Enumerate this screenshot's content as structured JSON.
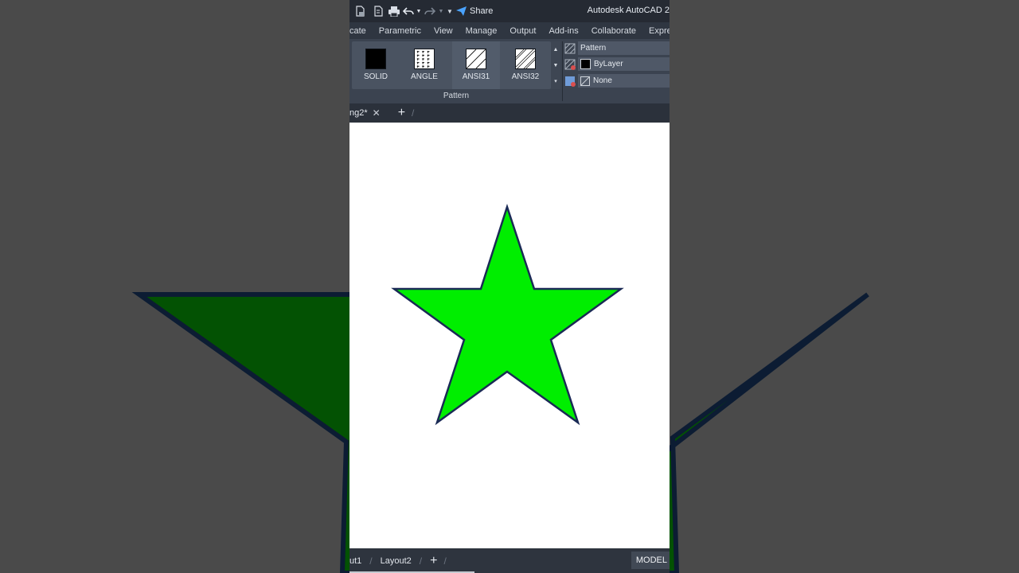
{
  "app": {
    "title": "Autodesk AutoCAD 2",
    "share_label": "Share"
  },
  "ribbon": {
    "tabs": [
      "cate",
      "Parametric",
      "View",
      "Manage",
      "Output",
      "Add-ins",
      "Collaborate",
      "Express Tool"
    ],
    "patterns": [
      {
        "label": "SOLID",
        "icon": "solid-swatch-icon"
      },
      {
        "label": "ANGLE",
        "icon": "angle-swatch-icon"
      },
      {
        "label": "ANSI31",
        "icon": "ansi31-swatch-icon"
      },
      {
        "label": "ANSI32",
        "icon": "ansi32-swatch-icon"
      }
    ],
    "panel_label": "Pattern",
    "properties": {
      "type": "Pattern",
      "color": "ByLayer",
      "background": "None"
    }
  },
  "document": {
    "tab_label": "ng2*"
  },
  "canvas": {
    "shape": "star",
    "fill_color": "#00ee00",
    "outline_color": "#1a2a55"
  },
  "background": {
    "star_fill": "#035203",
    "star_outline": "#0c1c33"
  },
  "status": {
    "layout_tabs": [
      "ut1",
      "Layout2"
    ],
    "model_label": "MODEL"
  }
}
